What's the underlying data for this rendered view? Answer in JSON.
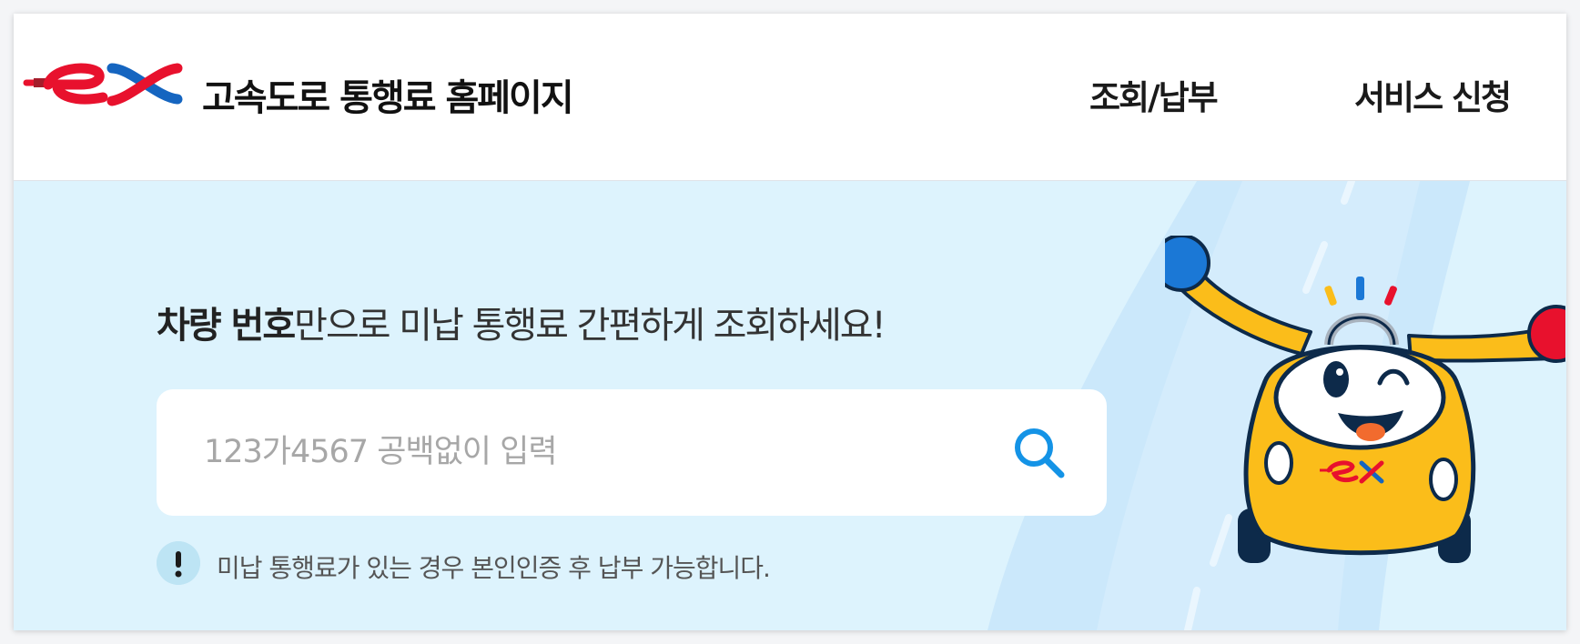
{
  "header": {
    "logo_text": "ex",
    "site_title": "고속도로 통행료 홈페이지",
    "nav": [
      {
        "label": "조회/납부"
      },
      {
        "label": "서비스 신청"
      }
    ]
  },
  "hero": {
    "headline_strong": "차량 번호",
    "headline_rest": "만으로 미납 통행료 간편하게 조회하세요!",
    "search": {
      "placeholder": "123가4567 공백없이 입력",
      "value": "",
      "button_icon": "search-icon"
    },
    "notice": {
      "icon": "exclamation-icon",
      "text": "미납 통행료가 있는 경우 본인인증 후 납부 가능합니다."
    },
    "mascot_badge_text": "ex"
  },
  "colors": {
    "brand_red": "#e8112d",
    "brand_blue": "#1565c0",
    "hero_bg": "#ddf3fd",
    "search_icon": "#1493e6",
    "mascot_yellow": "#fbbd1a"
  }
}
